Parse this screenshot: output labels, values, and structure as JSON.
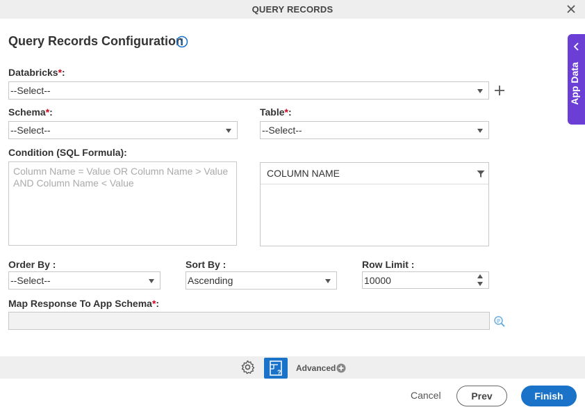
{
  "window": {
    "title": "QUERY RECORDS"
  },
  "heading": "Query Records Configuration",
  "form": {
    "databricks": {
      "label": "Databricks",
      "value": "--Select--"
    },
    "schema": {
      "label": "Schema",
      "value": "--Select--"
    },
    "table": {
      "label": "Table",
      "value": "--Select--"
    },
    "condition": {
      "label": "Condition (SQL Formula):",
      "placeholder": "Column Name = Value OR Column Name > Value AND Column Name < Value"
    },
    "column_panel": {
      "header": "COLUMN NAME"
    },
    "order_by": {
      "label": "Order By :",
      "value": "--Select--"
    },
    "sort_by": {
      "label": "Sort By :",
      "value": "Ascending"
    },
    "row_limit": {
      "label": "Row Limit :",
      "value": "10000"
    },
    "map_response": {
      "label": "Map Response To App Schema",
      "value": ""
    },
    "required_marker": "*",
    "colon": ":"
  },
  "side_panel": {
    "label": "App Data"
  },
  "toolbar": {
    "advanced_label": "Advanced"
  },
  "footer": {
    "cancel": "Cancel",
    "prev": "Prev",
    "finish": "Finish"
  },
  "colors": {
    "primary": "#1a73c8",
    "side_panel": "#6b3fd6",
    "required": "#d0021b"
  },
  "icons": [
    "close-icon",
    "info-icon",
    "plus-icon",
    "filter-icon",
    "search-icon",
    "gear-icon",
    "document-help-icon",
    "add-circle-icon",
    "chevron-left-icon"
  ]
}
